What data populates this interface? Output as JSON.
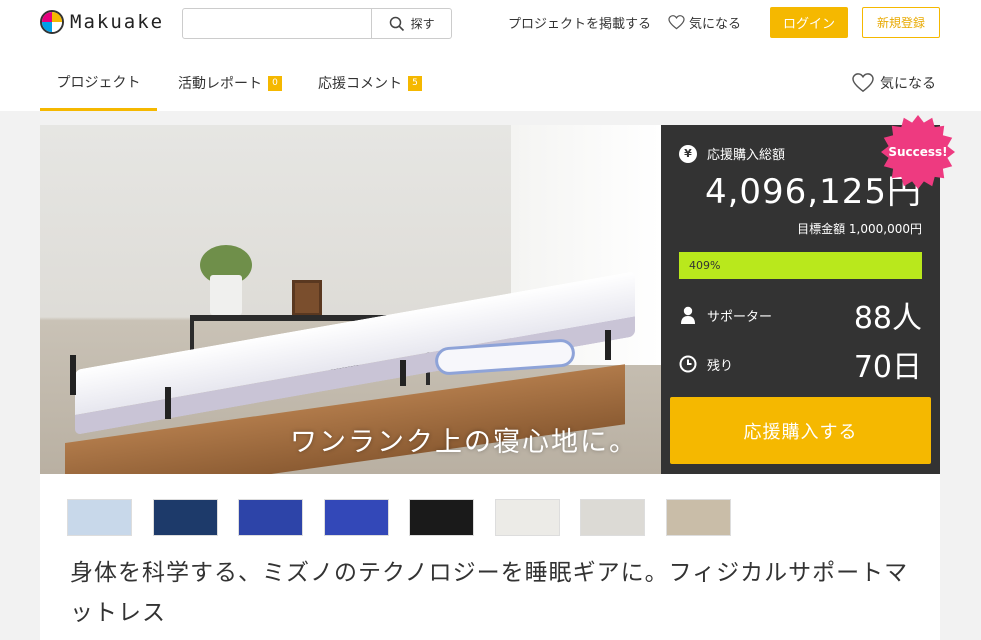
{
  "header": {
    "logo_text": "Makuake",
    "search": {
      "placeholder": "",
      "button_label": "探す"
    },
    "publish_link": "プロジェクトを掲載する",
    "favorite_link": "気になる",
    "login_button": "ログイン",
    "register_button": "新規登録"
  },
  "tabs": {
    "project": "プロジェクト",
    "report": "活動レポート",
    "report_count": "0",
    "comment": "応援コメント",
    "comment_count": "5",
    "favorite": "気になる"
  },
  "hero": {
    "catchphrase": "ワンランク上の寝心地に。"
  },
  "funding": {
    "badge": "Success!",
    "total_label": "応援購入総額",
    "total_amount": "4,096,125円",
    "goal_text": "目標金額 1,000,000円",
    "progress_text": "409%",
    "progress_fraction": 1.0,
    "supporters_label": "サポーター",
    "supporters_value": "88人",
    "remaining_label": "残り",
    "remaining_value": "70日",
    "cta_label": "応援購入する",
    "colors": {
      "accent": "#f5b800",
      "progress": "#b9e81c",
      "badge": "#ee3a80",
      "panel": "#333333"
    }
  },
  "thumbnails": [
    {
      "name": "thumb-1",
      "color": "#c8d8ea"
    },
    {
      "name": "thumb-2",
      "color": "#1d3a6a"
    },
    {
      "name": "thumb-3",
      "color": "#2d44a8"
    },
    {
      "name": "thumb-4",
      "color": "#3348b8"
    },
    {
      "name": "thumb-5",
      "color": "#1a1a1a"
    },
    {
      "name": "thumb-6",
      "color": "#ecebe7"
    },
    {
      "name": "thumb-7",
      "color": "#dcdad5"
    },
    {
      "name": "thumb-8",
      "color": "#c9bda8"
    }
  ],
  "project_title": "身体を科学する、ミズノのテクノロジーを睡眠ギアに。フィジカルサポートマットレス"
}
